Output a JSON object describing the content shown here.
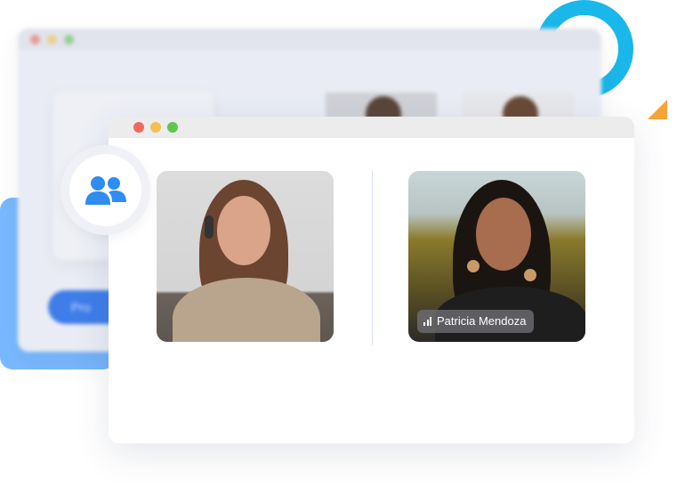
{
  "colors": {
    "accent_blue": "#2f8cf0",
    "ring": "#1ab7ea",
    "triangle": "#f7a436",
    "back_square": "#79b8ff"
  },
  "back_window": {
    "button_label": "Pro"
  },
  "front_window": {
    "participants": [
      {
        "name": "",
        "photo": "woman-with-headset"
      },
      {
        "name": "Patricia Mendoza",
        "photo": "woman-smiling-outdoors",
        "signal_icon": "signal-bars-icon"
      }
    ]
  },
  "group_icon": "users-icon"
}
